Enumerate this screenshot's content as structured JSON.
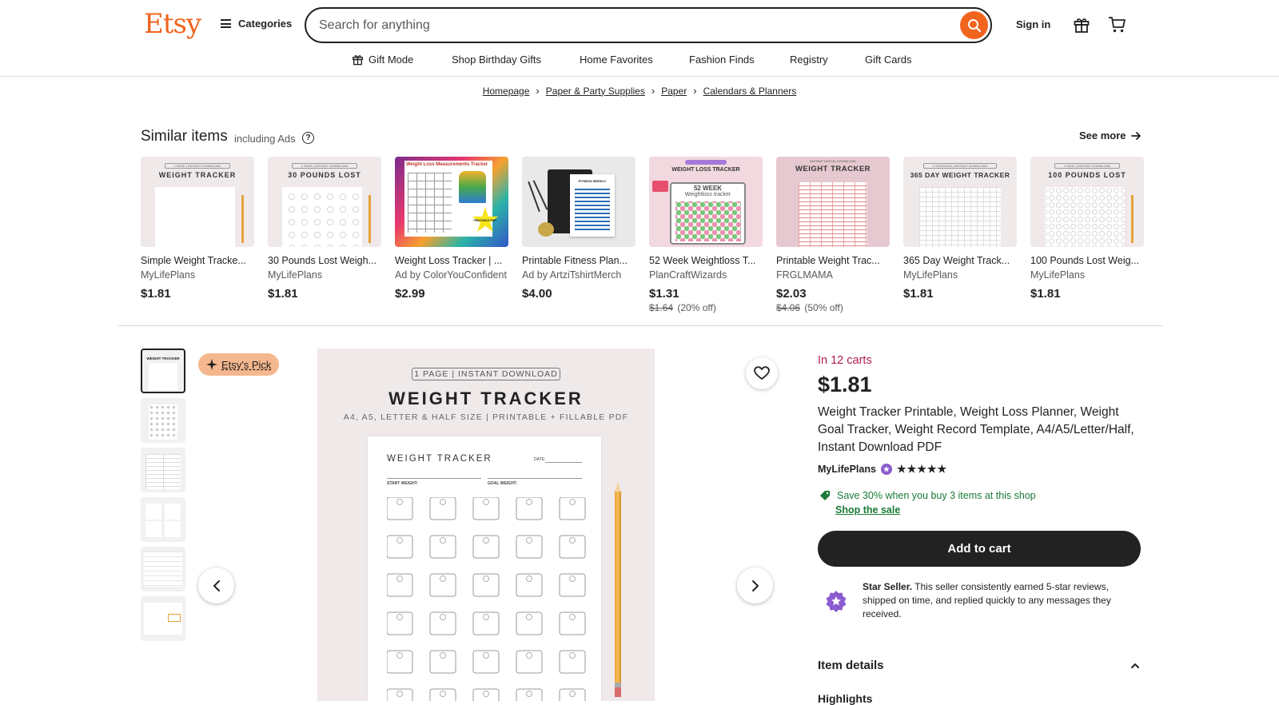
{
  "header": {
    "logo": "Etsy",
    "categories_label": "Categories",
    "search_placeholder": "Search for anything",
    "signin_label": "Sign in"
  },
  "subnav": {
    "items": [
      "Gift Mode",
      "Shop Birthday Gifts",
      "Home Favorites",
      "Fashion Finds",
      "Registry",
      "Gift Cards"
    ]
  },
  "breadcrumb": [
    "Homepage",
    "Paper & Party Supplies",
    "Paper",
    "Calendars & Planners"
  ],
  "similar": {
    "title": "Similar items",
    "subtitle": "including Ads",
    "see_more": "See more",
    "items": [
      {
        "title": "Simple Weight Tracke...",
        "shop": "MyLifePlans",
        "price": "$1.81",
        "img_heading": "WEIGHT TRACKER",
        "img_tag": "1 PAGE | INSTANT DOWNLOAD"
      },
      {
        "title": "30 Pounds Lost Weigh...",
        "shop": "MyLifePlans",
        "price": "$1.81",
        "img_heading": "30 POUNDS LOST",
        "img_tag": "1 PAGE | INSTANT DOWNLOAD"
      },
      {
        "title": "Weight Loss Tracker | ...",
        "shop": "Ad by ColorYouConfident",
        "price": "$2.99",
        "img_heading": "Weight Loss Measurements Tracker",
        "img_tag": "PRINTABLE PDF!"
      },
      {
        "title": "Printable Fitness Plan...",
        "shop": "Ad by ArtziTshirtMerch",
        "price": "$4.00",
        "img_heading": "FITNESS WEEKLY",
        "img_tag": ""
      },
      {
        "title": "52 Week Weightloss T...",
        "shop": "PlanCraftWizards",
        "price": "$1.31",
        "orig_price": "$1.64",
        "discount": "(20% off)",
        "img_heading": "WEIGHT LOSS TRACKER",
        "img_tag": "52 WEEK",
        "img_sub": "Weightloss tracker"
      },
      {
        "title": "Printable Weight Trac...",
        "shop": "FRGLMAMA",
        "price": "$2.03",
        "orig_price": "$4.06",
        "discount": "(50% off)",
        "img_heading": "WEIGHT TRACKER",
        "img_tag": "INSTANT DIGITAL DOWNLOAD"
      },
      {
        "title": "365 Day Weight Track...",
        "shop": "MyLifePlans",
        "price": "$1.81",
        "img_heading": "365 DAY WEIGHT TRACKER",
        "img_tag": "4 VERSIONS | INSTANT DOWNLOAD"
      },
      {
        "title": "100 Pounds Lost Weig...",
        "shop": "MyLifePlans",
        "price": "$1.81",
        "img_heading": "100 POUNDS LOST",
        "img_tag": "1 PAGE | INSTANT DOWNLOAD"
      }
    ]
  },
  "gallery": {
    "badge": "Etsy's Pick",
    "image": {
      "tag": "1 PAGE | INSTANT DOWNLOAD",
      "heading": "WEIGHT TRACKER",
      "sub": "A4, A5, LETTER & HALF SIZE | PRINTABLE + FILLABLE PDF",
      "sheet_title": "WEIGHT TRACKER",
      "date_label": "DATE:",
      "start_label": "START WEIGHT:",
      "goal_label": "GOAL WEIGHT:"
    }
  },
  "product": {
    "in_carts": "In 12 carts",
    "price": "$1.81",
    "title": "Weight Tracker Printable, Weight Loss Planner, Weight Goal Tracker, Weight Record Template, A4/A5/Letter/Half, Instant Download PDF",
    "shop": "MyLifePlans",
    "rating_stars": "★★★★★",
    "promo": "Save 30% when you buy 3 items at this shop",
    "promo_link": "Shop the sale",
    "add_to_cart": "Add to cart",
    "star_seller_bold": "Star Seller.",
    "star_seller_text": " This seller consistently earned 5-star reviews, shipped on time, and replied quickly to any messages they received.",
    "item_details": "Item details",
    "highlights": "Highlights"
  },
  "colors": {
    "brand": "#F1641E",
    "cart_alert": "#B01E46",
    "promo_green": "#1a7a36",
    "star_seller": "#8b5bd0"
  }
}
